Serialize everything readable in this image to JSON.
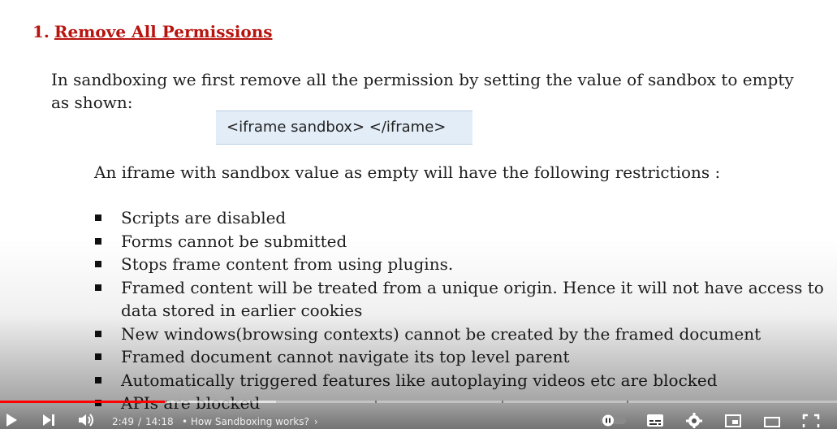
{
  "slide": {
    "heading_number": "1.",
    "heading_text": "Remove All Permissions",
    "intro": "In sandboxing we first remove all the permission by setting the value of sandbox to empty  as shown:",
    "code": "<iframe sandbox> </iframe>",
    "subline": "An iframe with sandbox value as empty will have the following restrictions :",
    "bullets": [
      "Scripts are disabled",
      "Forms cannot be submitted",
      "Stops frame content from using plugins.",
      "Framed content will be treated from a unique origin. Hence it will not have access to data stored in earlier cookies",
      "New windows(browsing contexts)  cannot be created by the framed document",
      "Framed document cannot navigate its top level parent",
      "Automatically triggered features like autoplaying videos etc are blocked",
      "APIs are blocked"
    ]
  },
  "player": {
    "current_time": "2:49",
    "time_separator": "/",
    "duration": "14:18",
    "chapter_dot": "•",
    "chapter_title": "How Sandboxing works?",
    "progress_fraction": 0.197,
    "accent_color": "#ff0000",
    "icons": [
      "play-icon",
      "next-icon",
      "volume-icon",
      "autoplay-toggle",
      "subtitles-icon",
      "settings-icon",
      "miniplayer-icon",
      "theater-icon",
      "fullscreen-icon"
    ]
  }
}
